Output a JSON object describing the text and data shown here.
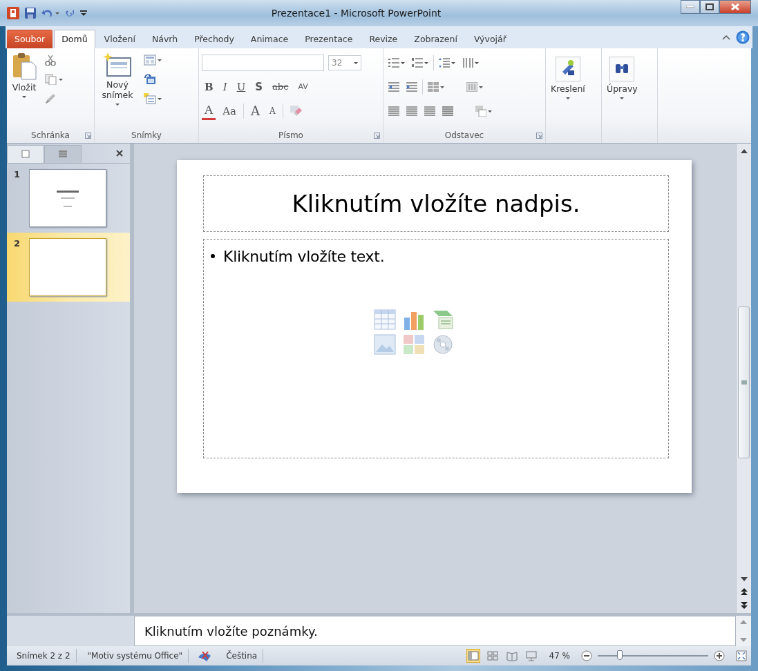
{
  "window": {
    "title": "Prezentace1 - Microsoft PowerPoint"
  },
  "ribbon_tabs": [
    {
      "label": "Soubor",
      "kind": "file",
      "selected": false
    },
    {
      "label": "Domů",
      "kind": "tab",
      "selected": true
    },
    {
      "label": "Vložení",
      "kind": "tab",
      "selected": false
    },
    {
      "label": "Návrh",
      "kind": "tab",
      "selected": false
    },
    {
      "label": "Přechody",
      "kind": "tab",
      "selected": false
    },
    {
      "label": "Animace",
      "kind": "tab",
      "selected": false
    },
    {
      "label": "Prezentace",
      "kind": "tab",
      "selected": false
    },
    {
      "label": "Revize",
      "kind": "tab",
      "selected": false
    },
    {
      "label": "Zobrazení",
      "kind": "tab",
      "selected": false
    },
    {
      "label": "Vývojář",
      "kind": "tab",
      "selected": false
    }
  ],
  "ribbon_groups": [
    {
      "kind": "clipboard",
      "label": "Schránka",
      "button": "Vložit",
      "launcher": true
    },
    {
      "kind": "slides",
      "label": "Snímky",
      "button": "Nový snímek",
      "launcher": false
    },
    {
      "kind": "font",
      "label": "Písmo",
      "launcher": true,
      "font_size": "32",
      "format_buttons": [
        {
          "text": "B",
          "kind": "bold"
        },
        {
          "text": "I",
          "kind": "italic"
        },
        {
          "text": "U",
          "kind": "underline"
        },
        {
          "text": "S",
          "kind": "shadow"
        },
        {
          "text": "abc",
          "kind": "strike"
        },
        {
          "text": "AV",
          "kind": "spacing"
        }
      ],
      "size_buttons": [
        {
          "text": "A",
          "kind": "color"
        },
        {
          "text": "Aa",
          "kind": "case"
        },
        {
          "text": "A",
          "kind": "grow"
        },
        {
          "text": "A",
          "kind": "shrink"
        }
      ]
    },
    {
      "kind": "paragraph",
      "label": "Odstavec",
      "launcher": true
    },
    {
      "kind": "drawing",
      "button": "Kreslení"
    },
    {
      "kind": "editing",
      "button": "Úpravy"
    }
  ],
  "slides_panel": {
    "tabs": [
      {
        "kind": "slides",
        "selected": true
      },
      {
        "kind": "outline",
        "selected": false
      }
    ],
    "thumbnails": [
      {
        "number": "1",
        "kind": "title",
        "selected": false
      },
      {
        "number": "2",
        "kind": "blank",
        "selected": true
      }
    ]
  },
  "slide": {
    "title": "Kliknutím vložíte nadpis.",
    "body": "Kliknutím vložíte text."
  },
  "notes": {
    "text": "Kliknutím vložíte poznámky."
  },
  "status_bar": {
    "slide": "Snímek 2 z 2",
    "theme": "\"Motiv systému Office\"",
    "language": "Čeština",
    "views": [
      {
        "kind": "normal",
        "selected": true
      },
      {
        "kind": "sorter",
        "selected": false
      },
      {
        "kind": "reading",
        "selected": false
      },
      {
        "kind": "show",
        "selected": false
      }
    ],
    "zoom": "47 %",
    "zoom_slider": {
      "level": 0.2
    }
  }
}
